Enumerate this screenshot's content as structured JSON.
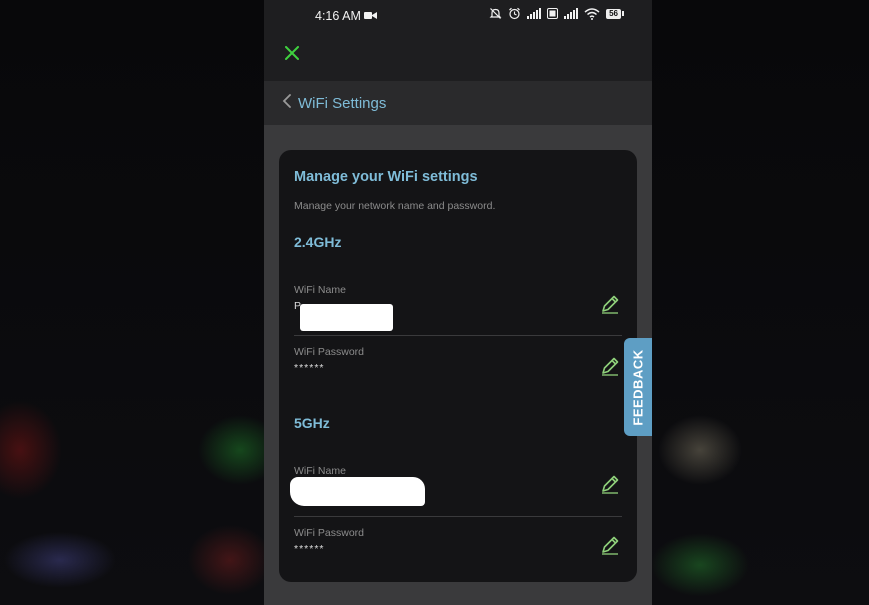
{
  "status_bar": {
    "time": "4:16 AM",
    "battery_level": "56",
    "icons": [
      "video-camera-icon",
      "mute-bell-icon",
      "alarm-icon",
      "signal-icon",
      "volte-icon",
      "signal-icon",
      "wifi-icon",
      "battery-icon"
    ]
  },
  "top_bar": {
    "close_icon": "close-icon",
    "accent_color": "#3fd13f"
  },
  "nav": {
    "back_icon": "chevron-left-icon",
    "title": "WiFi Settings"
  },
  "card": {
    "title": "Manage your WiFi settings",
    "subtitle": "Manage your network name and password.",
    "bands": [
      {
        "title": "2.4GHz",
        "name_label": "WiFi Name",
        "name_value": "P",
        "password_label": "WiFi Password",
        "password_value": "******"
      },
      {
        "title": "5GHz",
        "name_label": "WiFi Name",
        "name_value": "",
        "password_label": "WiFi Password",
        "password_value": "******"
      }
    ],
    "edit_icon": "pencil-icon",
    "edit_icon_color": "#8fd17a"
  },
  "feedback": {
    "label": "FEEDBACK",
    "color": "#5e9ec4"
  },
  "colors": {
    "heading": "#7fbcd8",
    "card_background": "#141416",
    "page_background": "#3a3a3c"
  }
}
